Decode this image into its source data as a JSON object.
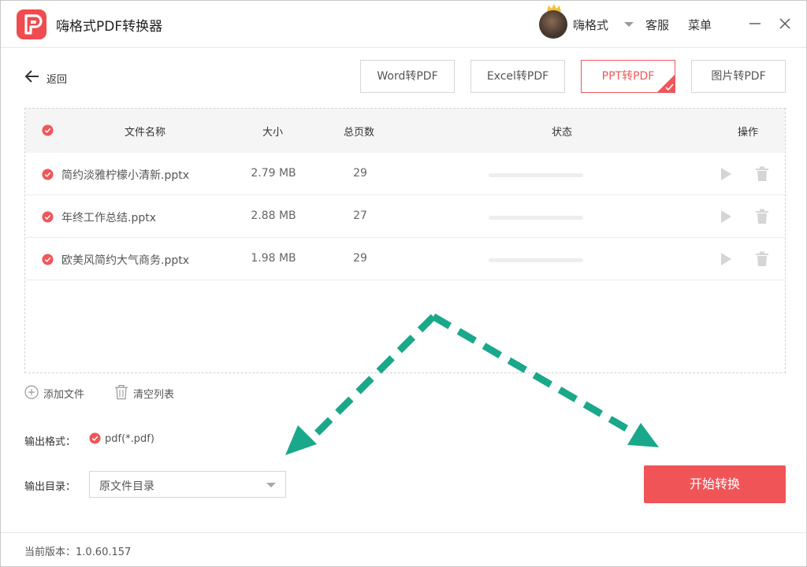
{
  "app": {
    "title": "嗨格式PDF转换器"
  },
  "header": {
    "username": "嗨格式",
    "service_label": "客服",
    "menu_label": "菜单"
  },
  "back_label": "返回",
  "tabs": [
    {
      "label": "Word转PDF",
      "active": false
    },
    {
      "label": "Excel转PDF",
      "active": false
    },
    {
      "label": "PPT转PDF",
      "active": true
    },
    {
      "label": "图片转PDF",
      "active": false
    }
  ],
  "table": {
    "columns": {
      "name": "文件名称",
      "size": "大小",
      "pages": "总页数",
      "status": "状态",
      "actions": "操作"
    },
    "rows": [
      {
        "name": "简约淡雅柠檬小清新.pptx",
        "size": "2.79 MB",
        "pages": "29",
        "progress": 0,
        "checked": true
      },
      {
        "name": "年终工作总结.pptx",
        "size": "2.88 MB",
        "pages": "27",
        "progress": 0,
        "checked": true
      },
      {
        "name": "欧美风简约大气商务.pptx",
        "size": "1.98 MB",
        "pages": "29",
        "progress": 0,
        "checked": true
      }
    ]
  },
  "actions": {
    "add_file": "添加文件",
    "clear_list": "清空列表"
  },
  "output": {
    "format_label": "输出格式：",
    "format_value": "pdf(*.pdf)",
    "dir_label": "输出目录：",
    "dir_value": "原文件目录"
  },
  "start_button": "开始转换",
  "footer": {
    "version_text": "当前版本：1.0.60.157"
  },
  "colors": {
    "accent": "#f05457",
    "annotation_arrow": "#1aa88a"
  },
  "icons": {
    "logo": "pdf-logo-icon",
    "back": "arrow-left-icon",
    "minimize": "minimize-icon",
    "close": "close-icon",
    "check": "check-circle-icon",
    "play": "play-icon",
    "delete": "trash-icon",
    "add": "plus-circle-icon",
    "clear": "trash-icon",
    "dropdown": "chevron-down-icon"
  }
}
